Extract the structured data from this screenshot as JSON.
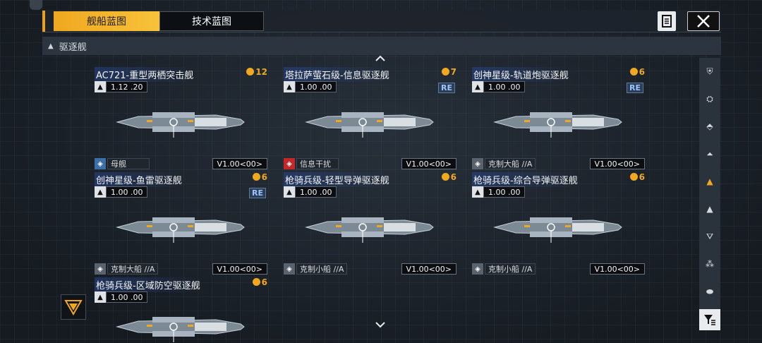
{
  "tabs": [
    {
      "label": "舰船蓝图",
      "active": true
    },
    {
      "label": "技术蓝图",
      "active": false
    }
  ],
  "section": {
    "label": "驱逐舰"
  },
  "icons": {
    "document": "document-icon",
    "close": "close-icon",
    "filter": "filter-icon",
    "scroll_up": "chevron-up-icon",
    "scroll_down": "chevron-down-icon"
  },
  "colors": {
    "accent": "#f0a820",
    "re_tag": "#9cc4ff",
    "trait_red": "#c0282a"
  },
  "ships": [
    {
      "name": "AC721-重型两栖突击舰",
      "cost": "12",
      "stat": "1.12 .20",
      "stat_icon": "globe-icon",
      "re": "",
      "trait": "母舰",
      "trait_type": "blue",
      "version": "V1.00<00>"
    },
    {
      "name": "塔拉萨萤石级-信息驱逐舰",
      "cost": "7",
      "stat": "1.00 .00",
      "stat_icon": "ship-class-icon",
      "re": "RE",
      "trait": "信息干扰",
      "trait_type": "red",
      "version": "V1.00<00>"
    },
    {
      "name": "创神星级-轨道炮驱逐舰",
      "cost": "6",
      "stat": "1.00 .00",
      "stat_icon": "cannon-icon",
      "re": "RE",
      "trait": "克制大船 //A",
      "trait_type": "gray",
      "version": "V1.00<00>"
    },
    {
      "name": "创神星级-鱼雷驱逐舰",
      "cost": "6",
      "stat": "1.00 .00",
      "stat_icon": "torpedo-icon",
      "re": "RE",
      "trait": "克制大船 //A",
      "trait_type": "gray",
      "version": "V1.00<00>"
    },
    {
      "name": "枪骑兵级-轻型导弹驱逐舰",
      "cost": "6",
      "stat": "1.00 .00",
      "stat_icon": "missile-icon",
      "re": "",
      "trait": "克制小船 //A",
      "trait_type": "gray",
      "version": "V1.00<00>"
    },
    {
      "name": "枪骑兵级-综合导弹驱逐舰",
      "cost": "6",
      "stat": "1.00 .00",
      "stat_icon": "missile-icon",
      "re": "",
      "trait": "克制小船 //A",
      "trait_type": "gray",
      "version": "V1.00<00>"
    },
    {
      "name": "枪骑兵级-区域防空驱逐舰",
      "cost": "6",
      "stat": "1.00 .00",
      "stat_icon": "missile-icon",
      "re": "",
      "trait": "",
      "trait_type": "",
      "version": ""
    }
  ],
  "sidebar": {
    "items": [
      "carrier-class-icon",
      "battlecruiser-class-icon",
      "cruiser-class-icon",
      "frigate-class-icon",
      "destroyer-class-icon",
      "corvette-class-icon",
      "fighter-class-icon",
      "formation-icon",
      "base-icon"
    ],
    "active_index": 4
  }
}
